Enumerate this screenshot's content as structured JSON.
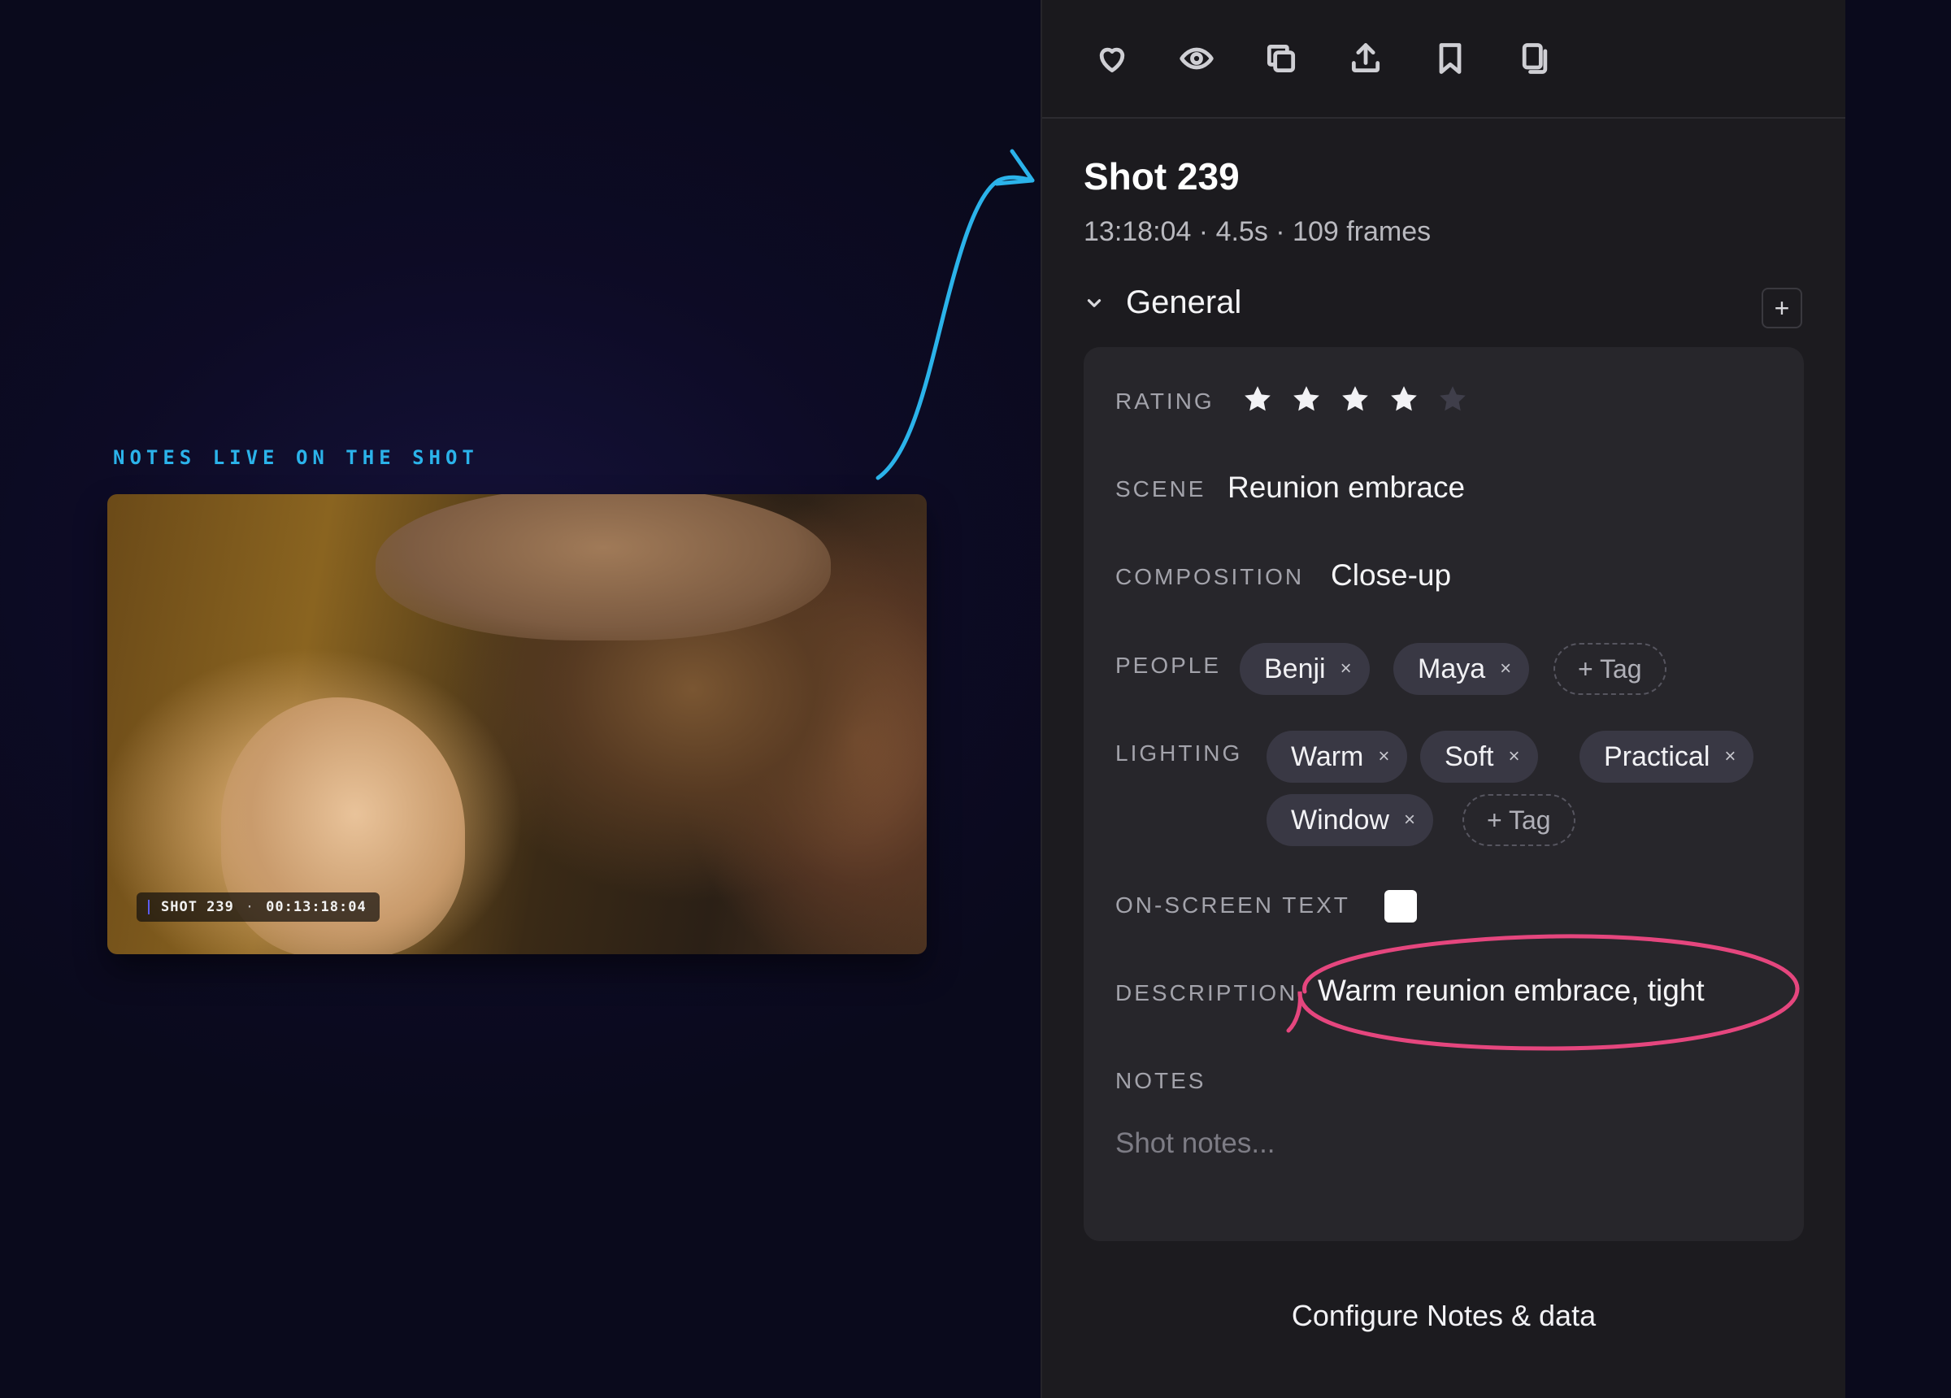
{
  "caption": "NOTES LIVE ON THE SHOT",
  "frame": {
    "badge_shot": "SHOT 239",
    "badge_sep": "·",
    "badge_timecode": "00:13:18:04"
  },
  "toolbar": {
    "icons": [
      "heart-icon",
      "eye-icon",
      "copy-icon",
      "share-icon",
      "bookmark-icon",
      "duplicate-icon"
    ]
  },
  "shot": {
    "title": "Shot 239",
    "meta": "13:18:04 · 4.5s · 109 frames"
  },
  "section": {
    "title": "General",
    "add_symbol": "+"
  },
  "fields": {
    "rating": {
      "label": "RATING",
      "value": 4,
      "max": 5
    },
    "scene": {
      "label": "SCENE",
      "value": "Reunion embrace"
    },
    "composition": {
      "label": "COMPOSITION",
      "value": "Close-up"
    },
    "people": {
      "label": "PEOPLE",
      "tags": [
        "Benji",
        "Maya"
      ],
      "add_label": "+ Tag"
    },
    "lighting": {
      "label": "LIGHTING",
      "tags": [
        "Warm",
        "Soft",
        "Practical",
        "Window"
      ],
      "add_label": "+ Tag"
    },
    "on_screen_text": {
      "label": "ON-SCREEN TEXT",
      "checked": false
    },
    "description": {
      "label": "DESCRIPTION",
      "value": "Warm reunion embrace, tight"
    },
    "notes": {
      "label": "NOTES",
      "placeholder": "Shot notes..."
    }
  },
  "tag_remove_symbol": "×",
  "footer": {
    "configure_label": "Configure Notes & data"
  },
  "colors": {
    "accent_blue": "#2bb3ea",
    "highlight_pink": "#e5467e",
    "panel_bg": "#1c1b1f",
    "card_bg": "#27262b",
    "star_on": "#f2f2f5",
    "star_off": "#3f3e4a"
  }
}
